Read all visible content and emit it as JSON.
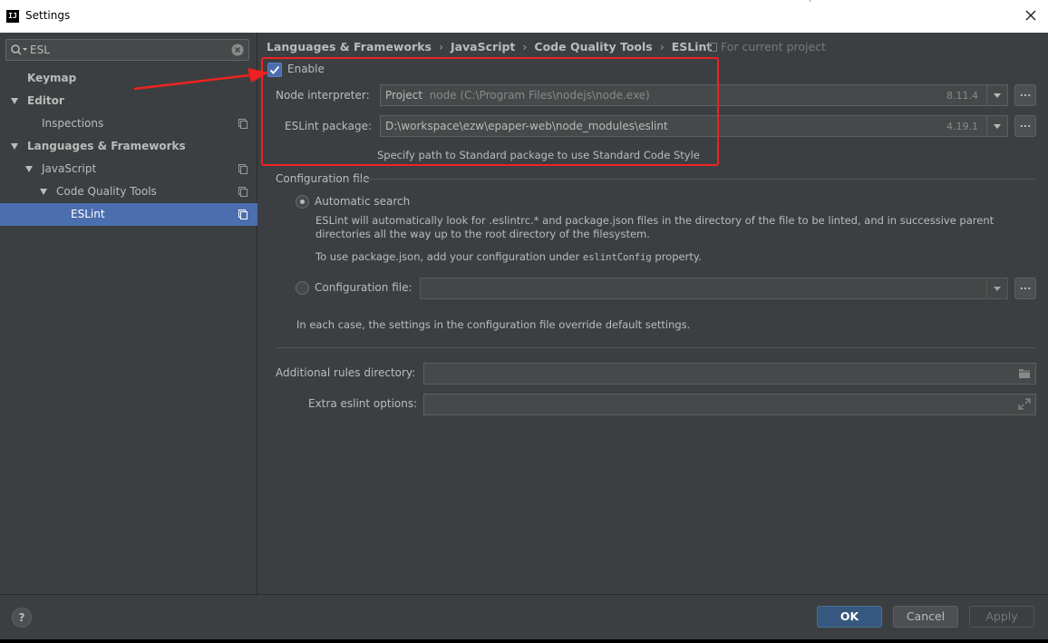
{
  "window": {
    "title": "Settings",
    "app_icon_label": "IJ"
  },
  "search": {
    "value": "ESL"
  },
  "tree": [
    {
      "label": "Keymap",
      "bold": true,
      "level": 0,
      "arrow": false,
      "copy": false,
      "selected": false
    },
    {
      "label": "Editor",
      "bold": true,
      "level": 0,
      "arrow": true,
      "copy": false,
      "selected": false
    },
    {
      "label": "Inspections",
      "bold": false,
      "level": 1,
      "arrow": false,
      "copy": true,
      "selected": false
    },
    {
      "label": "Languages & Frameworks",
      "bold": true,
      "level": 0,
      "arrow": true,
      "copy": false,
      "selected": false
    },
    {
      "label": "JavaScript",
      "bold": false,
      "level": 1,
      "arrow": true,
      "copy": true,
      "selected": false
    },
    {
      "label": "Code Quality Tools",
      "bold": false,
      "level": 2,
      "arrow": true,
      "copy": true,
      "selected": false
    },
    {
      "label": "ESLint",
      "bold": false,
      "level": 3,
      "arrow": false,
      "copy": true,
      "selected": true
    }
  ],
  "breadcrumb": [
    "Languages & Frameworks",
    "JavaScript",
    "Code Quality Tools",
    "ESLint"
  ],
  "breadcrumb_sep": "›",
  "for_current_project": "For current project",
  "enable": {
    "label": "Enable",
    "checked": true
  },
  "node_interpreter": {
    "label": "Node interpreter:",
    "prefix": "Project",
    "value": "node (C:\\Program Files\\nodejs\\node.exe)",
    "version": "8.11.4",
    "browse": "..."
  },
  "eslint_package": {
    "label": "ESLint package:",
    "value": "D:\\workspace\\ezw\\epaper-web\\node_modules\\eslint",
    "version": "4.19.1",
    "browse": "..."
  },
  "standard_hint": "Specify path to Standard package to use Standard Code Style",
  "config_section": {
    "title": "Configuration file",
    "automatic": {
      "label": "Automatic search",
      "selected": true,
      "desc1": "ESLint will automatically look for .eslintrc.* and package.json files in the directory of the file to be linted, and in successive parent directories all the way up to the root directory of the filesystem.",
      "desc2_prefix": "To use package.json, add your configuration under",
      "desc2_code": "eslintConfig",
      "desc2_suffix": "property."
    },
    "config_file": {
      "label": "Configuration file:",
      "selected": false,
      "value": "",
      "browse": "..."
    },
    "note": "In each case, the settings in the configuration file override default settings."
  },
  "rules_dir": {
    "label": "Additional rules directory:",
    "value": ""
  },
  "extra_options": {
    "label": "Extra eslint options:",
    "value": ""
  },
  "buttons": {
    "help": "?",
    "ok": "OK",
    "cancel": "Cancel",
    "apply": "Apply"
  },
  "colors": {
    "accent": "#4b6eaf",
    "annotation": "#ee2222",
    "background": "#3c3f41"
  }
}
